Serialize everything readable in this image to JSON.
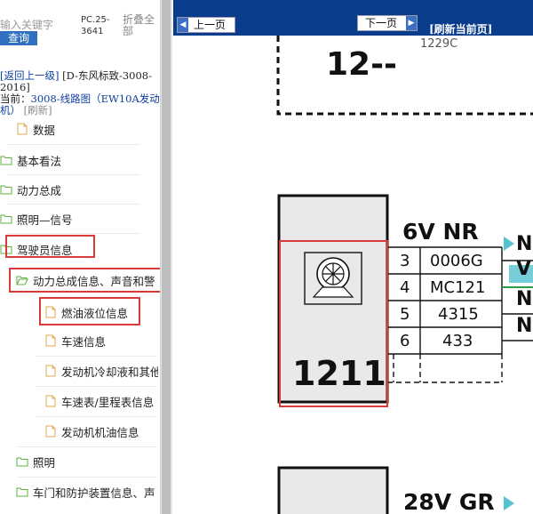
{
  "search": {
    "placeholder": "输入关键字",
    "button_label": "查询"
  },
  "header": {
    "pc_code": "PC.25-3641",
    "collapse_label": "折叠全部"
  },
  "breadcrumb": {
    "back_label": "[返回上一级]",
    "parent_name": "[D-东风标致-3008-2016]",
    "current_prefix": "当前：",
    "current_name": "3008-线路图（EW10A发动机）",
    "refresh_label": "[刷新]"
  },
  "tree": [
    {
      "label": "数据",
      "icon": "file-icon"
    },
    {
      "label": "基本看法",
      "icon": "folder-icon"
    },
    {
      "label": "动力总成",
      "icon": "folder-icon"
    },
    {
      "label": "照明—信号",
      "icon": "folder-icon"
    },
    {
      "label": "驾驶员信息",
      "icon": "folder-icon"
    },
    {
      "label": "动力总成信息、声音和警",
      "icon": "folder-open-icon"
    },
    {
      "label": "燃油液位信息",
      "icon": "file-icon"
    },
    {
      "label": "车速信息",
      "icon": "file-icon"
    },
    {
      "label": "发动机冷却液和其他",
      "icon": "file-icon"
    },
    {
      "label": "车速表/里程表信息",
      "icon": "file-icon"
    },
    {
      "label": "发动机机油信息",
      "icon": "file-icon"
    },
    {
      "label": "照明",
      "icon": "folder-icon"
    },
    {
      "label": "车门和防护装置信息、声",
      "icon": "folder-icon"
    }
  ],
  "viewer": {
    "prev_label": "上一页",
    "next_label": "下一页",
    "refresh_label": "[刷新当前页]"
  },
  "diagram": {
    "top_code": "1229C",
    "top_box_label": "12--",
    "component_number": "1211",
    "connector1_label": "6V NR",
    "connector1_pins": [
      {
        "pin": "3",
        "wire": "0006G"
      },
      {
        "pin": "4",
        "wire": "MC121"
      },
      {
        "pin": "5",
        "wire": "4315"
      },
      {
        "pin": "6",
        "wire": "433"
      }
    ],
    "connector2_label": "28V GR",
    "side_labels": [
      "N",
      "V",
      "N",
      "N"
    ]
  },
  "colors": {
    "topbar": "#0a3c8c",
    "highlight": "#d83a3a",
    "search_button": "#2f6fbe",
    "folder": "#6fbf4a",
    "file": "#e8b96a"
  }
}
